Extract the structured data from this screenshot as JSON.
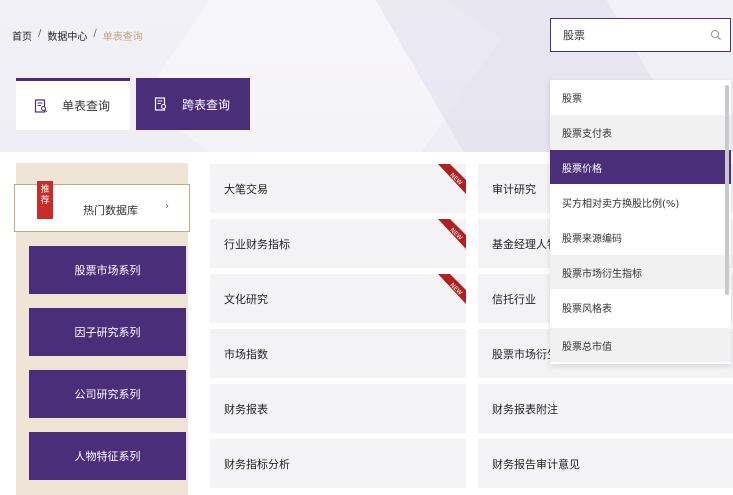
{
  "breadcrumb": {
    "home": "首页",
    "sep": "/",
    "data_center": "数据中心",
    "current": "单表查询"
  },
  "search": {
    "value": "股票"
  },
  "tabs": [
    {
      "label": "单表查询",
      "active": true
    },
    {
      "label": "跨表查询",
      "active": false
    }
  ],
  "sidebar": {
    "hot": {
      "badge": "推荐",
      "label": "热门数据库",
      "arrow": "›"
    },
    "items": [
      "股票市场系列",
      "因子研究系列",
      "公司研究系列",
      "人物特征系列"
    ]
  },
  "grid": {
    "col1": [
      {
        "label": "大笔交易",
        "new": true
      },
      {
        "label": "行业财务指标",
        "new": true
      },
      {
        "label": "文化研究",
        "new": true
      },
      {
        "label": "市场指数",
        "new": false
      },
      {
        "label": "财务报表",
        "new": false
      },
      {
        "label": "财务指标分析",
        "new": false
      }
    ],
    "col2": [
      "审计研究",
      "基金经理人物特",
      "信托行业",
      "股票市场衍生指",
      "财务报表附注",
      "财务报告审计意见"
    ],
    "new_label": "NEW"
  },
  "dropdown": {
    "items": [
      "股票",
      "股票支付表",
      "股票价格",
      "买方相对卖方换股比例(%)",
      "股票来源编码",
      "股票市场衍生指标",
      "股票风格表",
      "股票总市值"
    ],
    "selected_index": 2
  },
  "colors": {
    "primary": "#4a2e7a",
    "accent": "#c9a87c",
    "new": "#b02020"
  }
}
